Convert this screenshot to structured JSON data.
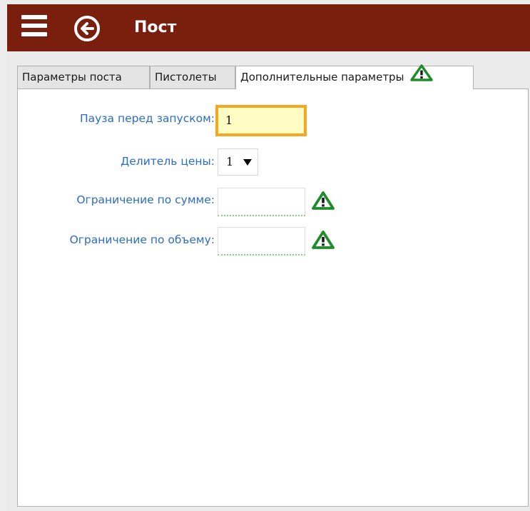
{
  "window": {
    "title": "Пост",
    "titlebar_color": "#7a1f0e",
    "icons": {
      "menu": "hamburger-menu-icon",
      "back": "back-arrow-circle-icon"
    }
  },
  "tabs": [
    {
      "label": "Параметры поста",
      "active": false
    },
    {
      "label": "Пистолеты",
      "active": false
    },
    {
      "label": "Дополнительные параметры",
      "active": true,
      "icon": "warning-icon"
    }
  ],
  "form": {
    "pause_before_start": {
      "label": "Пауза перед запуском:",
      "value": "1",
      "focused": true
    },
    "price_divider": {
      "label": "Делитель цены:",
      "value": "1",
      "icon": "dropdown-arrow-icon"
    },
    "sum_limit": {
      "label": "Ограничение по сумме:",
      "value": "",
      "icon": "warning-icon"
    },
    "volume_limit": {
      "label": "Ограничение по объему:",
      "value": "",
      "icon": "warning-icon"
    }
  },
  "colors": {
    "label": "#2a6cc6",
    "focus_border": "#f5a623",
    "focus_background": "#fffcc4",
    "warning_green": "#1e8c2a"
  }
}
